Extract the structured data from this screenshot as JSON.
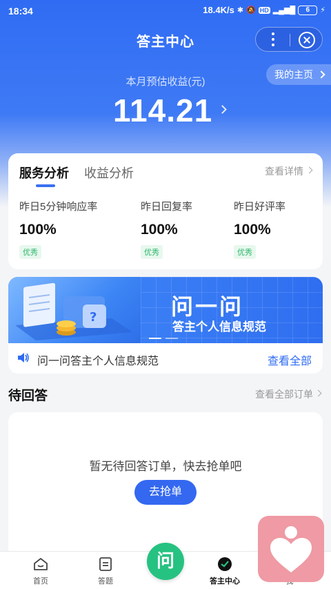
{
  "status_bar": {
    "time": "18:34",
    "speed": "18.4K/s",
    "battery": "6"
  },
  "header": {
    "title": "答主中心"
  },
  "home_link": {
    "label": "我的主页"
  },
  "earnings": {
    "label": "本月预估收益(元)",
    "value": "114.21"
  },
  "stats": {
    "tabs": [
      {
        "label": "服务分析",
        "active": true
      },
      {
        "label": "收益分析",
        "active": false
      }
    ],
    "detail_link": "查看详情",
    "metrics": [
      {
        "label": "昨日5分钟响应率",
        "value": "100%",
        "badge": "优秀"
      },
      {
        "label": "昨日回复率",
        "value": "100%",
        "badge": "优秀"
      },
      {
        "label": "昨日好评率",
        "value": "100%",
        "badge": "优秀"
      }
    ]
  },
  "banner": {
    "title": "问一问",
    "subtitle": "答主个人信息规范"
  },
  "notice": {
    "text": "问一问答主个人信息规范",
    "link": "查看全部"
  },
  "pending": {
    "title": "待回答",
    "link": "查看全部订单",
    "empty_text": "暂无待回答订单，快去抢单吧",
    "button": "去抢单"
  },
  "bottom_nav": {
    "items": [
      {
        "label": "首页"
      },
      {
        "label": "答题"
      },
      {
        "label": "答主中心"
      },
      {
        "label": "我"
      }
    ],
    "center_label": "问"
  },
  "colors": {
    "primary": "#2f6cf3",
    "success": "#2fb56b",
    "center_button": "#26c281",
    "widget": "#ef9aa4"
  }
}
